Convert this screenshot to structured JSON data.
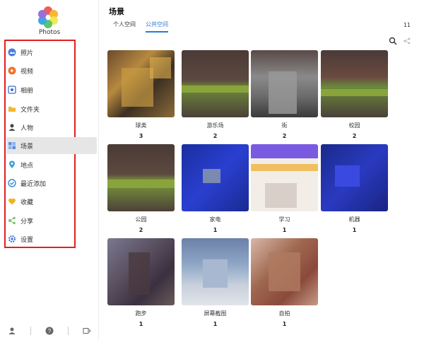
{
  "app": {
    "name": "Photos"
  },
  "sidebar": {
    "items": [
      {
        "label": "照片",
        "icon": "photo-icon",
        "color": "#4a7bd8"
      },
      {
        "label": "视频",
        "icon": "play-icon",
        "color": "#f0732a"
      },
      {
        "label": "相册",
        "icon": "album-icon",
        "color": "#3b6fd1"
      },
      {
        "label": "文件夹",
        "icon": "folder-icon",
        "color": "#f5b52c"
      },
      {
        "label": "人物",
        "icon": "person-icon",
        "color": "#444444"
      },
      {
        "label": "场景",
        "icon": "scene-icon",
        "color": "#5b8de8"
      },
      {
        "label": "地点",
        "icon": "location-icon",
        "color": "#39a0d8"
      },
      {
        "label": "最近添加",
        "icon": "check-circle-icon",
        "color": "#2f8ae0"
      },
      {
        "label": "收藏",
        "icon": "heart-icon",
        "color": "#f2b21c"
      },
      {
        "label": "分享",
        "icon": "share-icon",
        "color": "#7dc36e"
      },
      {
        "label": "设置",
        "icon": "gear-icon",
        "color": "#3b6fd1"
      }
    ],
    "active_index": 5
  },
  "main": {
    "title": "场景",
    "tabs": [
      {
        "label": "个人空间",
        "active": false
      },
      {
        "label": "公共空间",
        "active": true
      }
    ],
    "count": "11",
    "tools": [
      "search-icon",
      "share-icon"
    ],
    "scenes": [
      {
        "label": "球类",
        "count": "3"
      },
      {
        "label": "游乐场",
        "count": "2"
      },
      {
        "label": "街",
        "count": "2"
      },
      {
        "label": "校园",
        "count": "2"
      },
      {
        "label": "公园",
        "count": "2"
      },
      {
        "label": "家电",
        "count": "1"
      },
      {
        "label": "学习",
        "count": "1"
      },
      {
        "label": "机器",
        "count": "1"
      },
      {
        "label": "跑步",
        "count": "1"
      },
      {
        "label": "屏幕截图",
        "count": "1"
      },
      {
        "label": "自拍",
        "count": "1"
      }
    ]
  },
  "colors": {
    "accent": "#2a7ad6",
    "highlight_border": "#e02020"
  }
}
